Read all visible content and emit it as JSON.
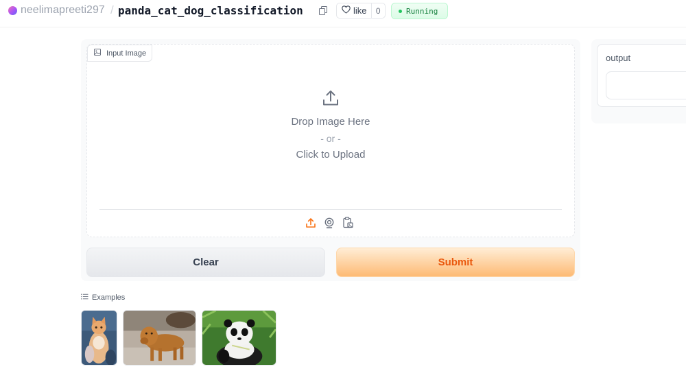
{
  "header": {
    "owner": "neelimapreeti297",
    "separator": "/",
    "space_name": "panda_cat_dog_classification",
    "like_label": "like",
    "like_count": "0",
    "status": "Running",
    "status_color": "#22c55e"
  },
  "input": {
    "label": "Input Image",
    "drop_text": "Drop Image Here",
    "or_text": "- or -",
    "click_text": "Click to Upload",
    "sources": [
      "upload-icon",
      "webcam-icon",
      "clipboard-icon"
    ],
    "active_source_color": "#f97316"
  },
  "buttons": {
    "clear": "Clear",
    "submit": "Submit"
  },
  "output": {
    "label": "output",
    "value": ""
  },
  "examples": {
    "label": "Examples",
    "items": [
      "cat",
      "dog",
      "panda"
    ]
  }
}
